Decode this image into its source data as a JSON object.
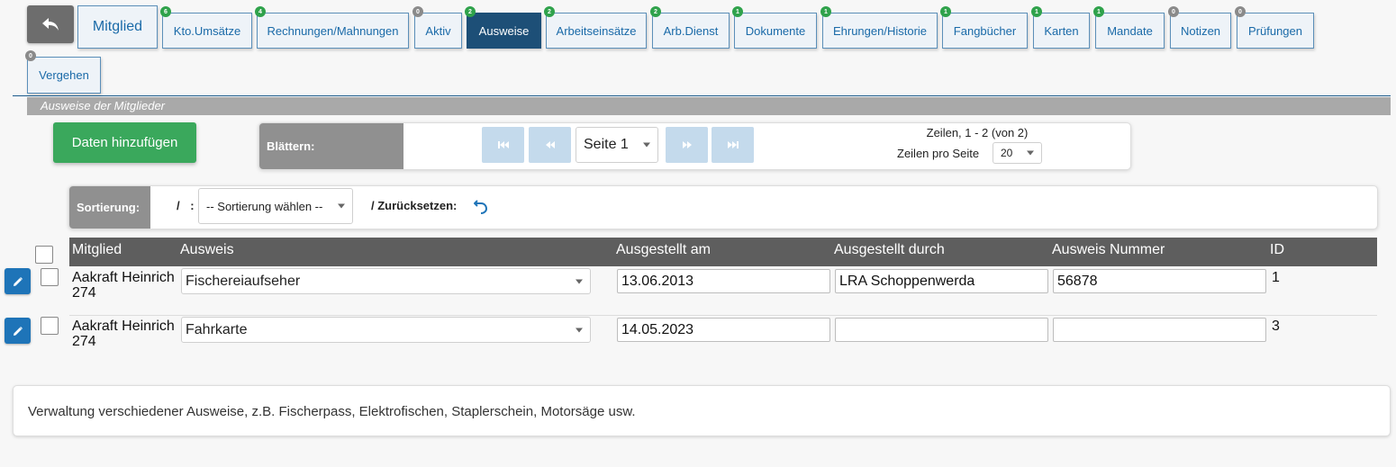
{
  "tabs": [
    {
      "label": "Mitglied",
      "badge": ""
    },
    {
      "label": "Kto.Umsätze",
      "badge": "6"
    },
    {
      "label": "Rechnungen/Mahnungen",
      "badge": "4"
    },
    {
      "label": "Aktiv",
      "badge": "0"
    },
    {
      "label": "Ausweise",
      "badge": "2"
    },
    {
      "label": "Arbeitseinsätze",
      "badge": "2"
    },
    {
      "label": "Arb.Dienst",
      "badge": "2"
    },
    {
      "label": "Dokumente",
      "badge": "1"
    },
    {
      "label": "Ehrungen/Historie",
      "badge": "1"
    },
    {
      "label": "Fangbücher",
      "badge": "1"
    },
    {
      "label": "Karten",
      "badge": "1"
    },
    {
      "label": "Mandate",
      "badge": "1"
    },
    {
      "label": "Notizen",
      "badge": "0"
    },
    {
      "label": "Prüfungen",
      "badge": "0"
    },
    {
      "label": "Vergehen",
      "badge": "0"
    }
  ],
  "section_title": "Ausweise der Mitglieder",
  "add_button": "Daten hinzufügen",
  "pager": {
    "label": "Blättern:",
    "page_select": "Seite 1",
    "rows_info": "Zeilen, 1 - 2 (von 2)",
    "rows_per_page_label": "Zeilen pro Seite",
    "rows_per_page_value": "20"
  },
  "sort": {
    "label": "Sortierung:",
    "separator": "/ :",
    "select": "-- Sortierung wählen --",
    "reset_label": "/ Zurücksetzen:"
  },
  "table": {
    "columns": [
      "Mitglied",
      "Ausweis",
      "Ausgestellt am",
      "Ausgestellt durch",
      "Ausweis Nummer",
      "ID"
    ],
    "rows": [
      {
        "member": "Aakraft Heinrich",
        "member_no": "274",
        "ausweis": "Fischereiaufseher",
        "date": "13.06.2013",
        "issuer": "LRA Schoppenwerda",
        "number": "56878",
        "id": "1"
      },
      {
        "member": "Aakraft Heinrich",
        "member_no": "274",
        "ausweis": "Fahrkarte",
        "date": "14.05.2023",
        "issuer": "",
        "number": "",
        "id": "3"
      }
    ]
  },
  "note": "Verwaltung verschiedener Ausweise, z.B. Fischerpass, Elektrofischen, Staplerschein, Motorsäge usw.",
  "colors": {
    "active_tab": "#1d4f77",
    "add_button": "#3aa85c",
    "badge_green": "#2fa24b",
    "edit_button": "#1e74b8"
  }
}
